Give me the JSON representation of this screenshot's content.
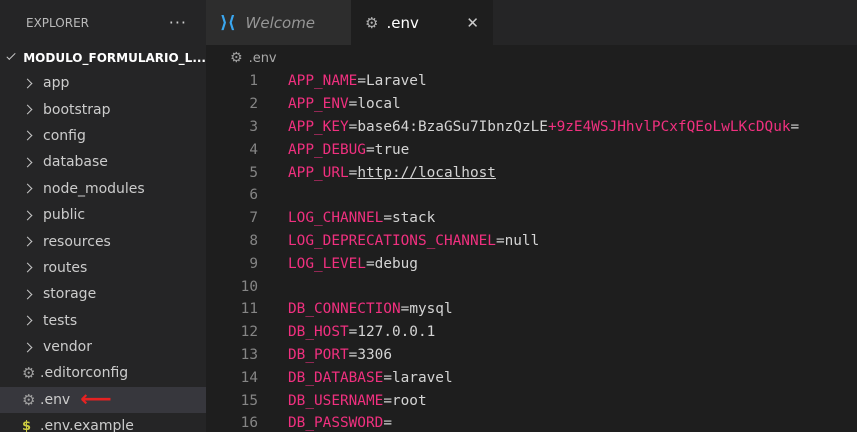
{
  "explorer": {
    "title": "EXPLORER",
    "more": "···",
    "root_folder": "MODULO_FORMULARIO_L...",
    "items": [
      {
        "label": "app",
        "type": "folder"
      },
      {
        "label": "bootstrap",
        "type": "folder"
      },
      {
        "label": "config",
        "type": "folder"
      },
      {
        "label": "database",
        "type": "folder"
      },
      {
        "label": "node_modules",
        "type": "folder"
      },
      {
        "label": "public",
        "type": "folder"
      },
      {
        "label": "resources",
        "type": "folder"
      },
      {
        "label": "routes",
        "type": "folder"
      },
      {
        "label": "storage",
        "type": "folder"
      },
      {
        "label": "tests",
        "type": "folder"
      },
      {
        "label": "vendor",
        "type": "folder"
      },
      {
        "label": ".editorconfig",
        "type": "config-file"
      },
      {
        "label": ".env",
        "type": "config-file",
        "selected": true
      },
      {
        "label": ".env.example",
        "type": "dollar-file"
      }
    ]
  },
  "tabs": [
    {
      "label": "Welcome",
      "icon": "vscode-icon",
      "active": false
    },
    {
      "label": ".env",
      "icon": "gear-icon",
      "active": true,
      "close": "✕"
    }
  ],
  "breadcrumb": {
    "file": ".env"
  },
  "editor": {
    "lines": [
      {
        "n": "1",
        "key": "APP_NAME",
        "value": "Laravel"
      },
      {
        "n": "2",
        "key": "APP_ENV",
        "value": "local"
      },
      {
        "n": "3",
        "key": "APP_KEY",
        "value": "base64:BzaGSu7IbnzQzLE",
        "value_plus": "+",
        "value_tail": "9zE4WSJHhvlPCxfQEoLwLKcDQuk",
        "value_end": "="
      },
      {
        "n": "4",
        "key": "APP_DEBUG",
        "value": "true"
      },
      {
        "n": "5",
        "key": "APP_URL",
        "value": "http://localhost",
        "url": true
      },
      {
        "n": "6"
      },
      {
        "n": "7",
        "key": "LOG_CHANNEL",
        "value": "stack"
      },
      {
        "n": "8",
        "key": "LOG_DEPRECATIONS_CHANNEL",
        "value": "null"
      },
      {
        "n": "9",
        "key": "LOG_LEVEL",
        "value": "debug"
      },
      {
        "n": "10"
      },
      {
        "n": "11",
        "key": "DB_CONNECTION",
        "value": "mysql"
      },
      {
        "n": "12",
        "key": "DB_HOST",
        "value": "127.0.0.1"
      },
      {
        "n": "13",
        "key": "DB_PORT",
        "value": "3306"
      },
      {
        "n": "14",
        "key": "DB_DATABASE",
        "value": "laravel"
      },
      {
        "n": "15",
        "key": "DB_USERNAME",
        "value": "root"
      },
      {
        "n": "16",
        "key": "DB_PASSWORD",
        "value": ""
      }
    ]
  },
  "colors": {
    "key": "#f0307f",
    "text": "#d4d4d4",
    "annotation_arrow": "#e52222"
  }
}
